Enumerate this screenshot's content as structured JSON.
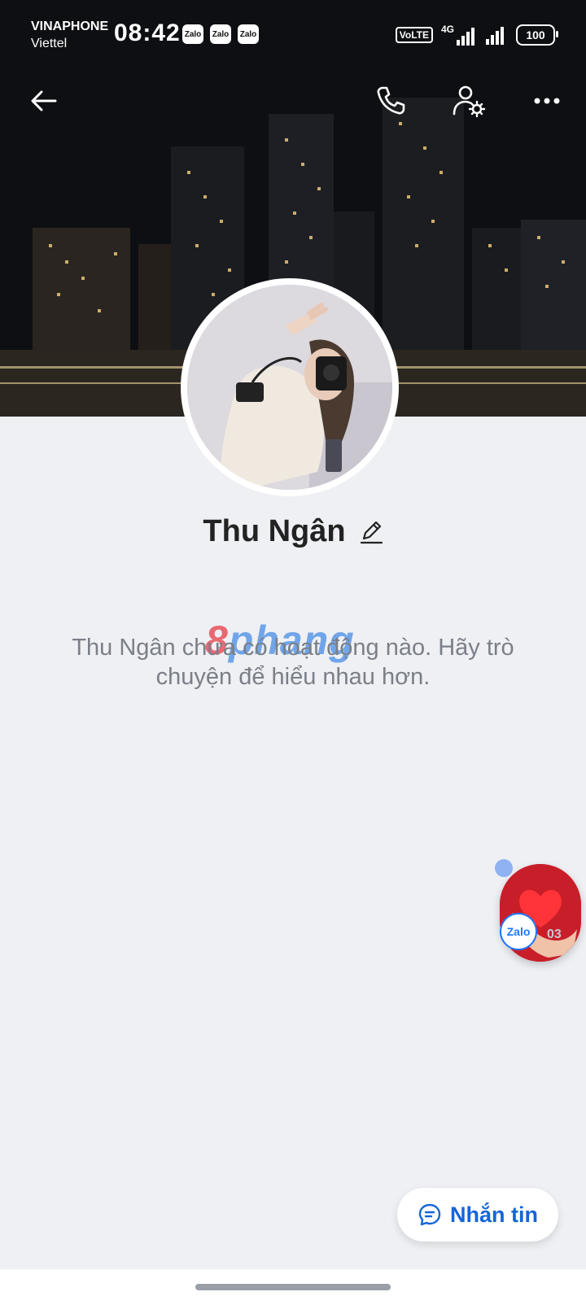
{
  "status_bar": {
    "carrier_1": "VINAPHONE",
    "carrier_2": "Viettel",
    "time": "08:42",
    "notification_apps": [
      "Zalo",
      "Zalo",
      "Zalo"
    ],
    "volte": "VoLTE",
    "network": "4G",
    "battery": "100"
  },
  "profile": {
    "name": "Thu Ngân",
    "empty_message": "Thu Ngân chưa có hoạt động nào. Hãy trò chuyện để hiểu nhau hơn."
  },
  "watermark": {
    "part1": "8",
    "part2": "phang"
  },
  "floating_bubble": {
    "app_label": "Zalo",
    "badge_text": "03"
  },
  "actions": {
    "message_label": "Nhắn tin"
  },
  "colors": {
    "accent": "#1565d8",
    "background": "#eef0f4"
  }
}
